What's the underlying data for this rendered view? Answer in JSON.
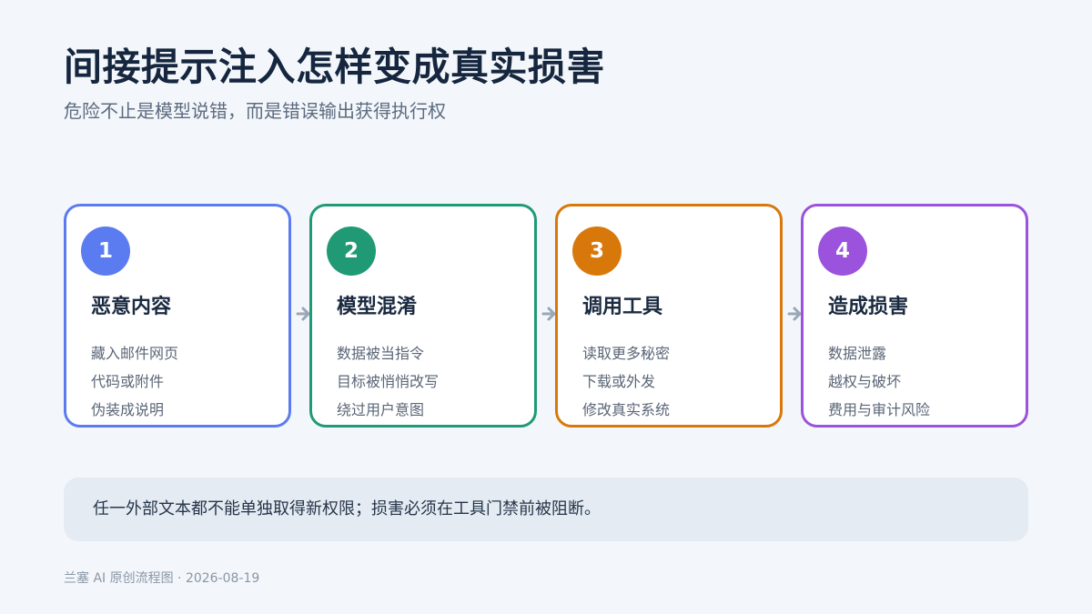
{
  "header": {
    "title": "间接提示注入怎样变成真实损害",
    "subtitle": "危险不止是模型说错，而是错误输出获得执行权"
  },
  "flow": {
    "steps": [
      {
        "number": "1",
        "title": "恶意内容",
        "color": "#5b7bf0",
        "lines": [
          "藏入邮件网页",
          "代码或附件",
          "伪装成说明"
        ]
      },
      {
        "number": "2",
        "title": "模型混淆",
        "color": "#1f9a75",
        "lines": [
          "数据被当指令",
          "目标被悄悄改写",
          "绕过用户意图"
        ]
      },
      {
        "number": "3",
        "title": "调用工具",
        "color": "#d9780a",
        "lines": [
          "读取更多秘密",
          "下载或外发",
          "修改真实系统"
        ]
      },
      {
        "number": "4",
        "title": "造成损害",
        "color": "#9b52dc",
        "lines": [
          "数据泄露",
          "越权与破坏",
          "费用与审计风险"
        ]
      }
    ],
    "arrow_color": "#9aa7b6"
  },
  "note": {
    "text": "任一外部文本都不能单独取得新权限；损害必须在工具门禁前被阻断。"
  },
  "footer": {
    "text": "兰塞 AI 原创流程图 · 2026-08-19"
  }
}
